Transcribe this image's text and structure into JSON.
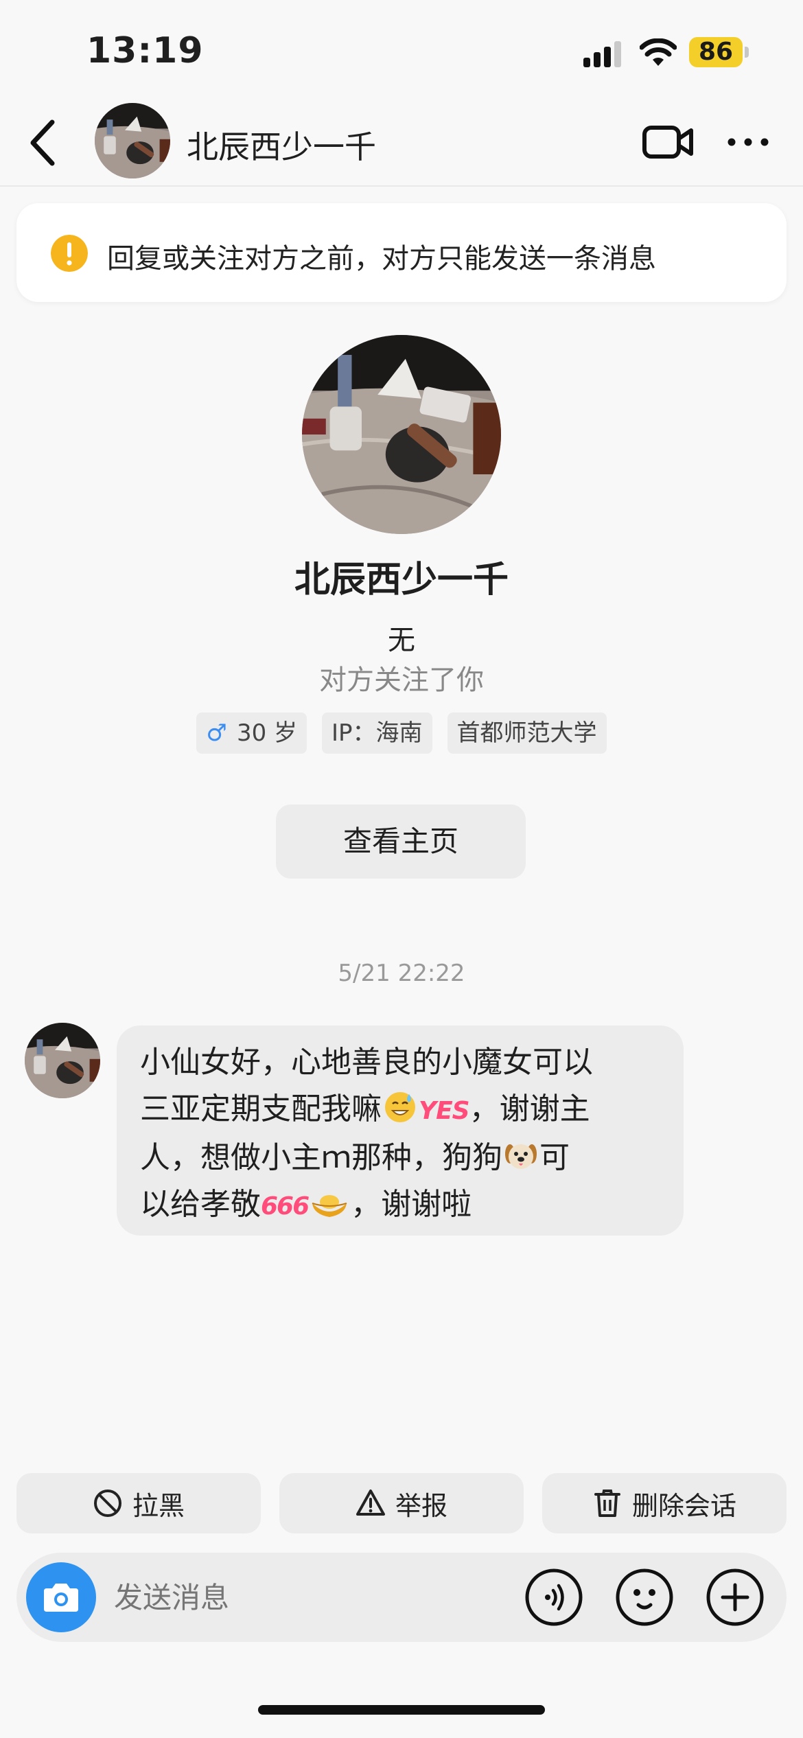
{
  "status_bar": {
    "time": "13:19",
    "battery": "86"
  },
  "header": {
    "name": "北辰西少一千"
  },
  "notice": {
    "text": "回复或关注对方之前，对方只能发送一条消息"
  },
  "profile": {
    "name": "北辰西少一千",
    "bio": "无",
    "follow_status": "对方关注了你",
    "tags": {
      "gender_symbol": "♂",
      "age": "30 岁",
      "ip": "IP：海南",
      "school": "首都师范大学"
    },
    "view_home_label": "查看主页"
  },
  "conversation": {
    "timestamp": "5/21 22:22",
    "message": {
      "line1": "小仙女好，心地善良的小魔女可以",
      "line2_pre": "三亚定期支配我嘛",
      "line2_yes": "YES",
      "line2_post": "，谢谢主",
      "line3_pre": "人，想做小主ｍ那种，狗狗",
      "line3_post": "可",
      "line4_pre": "以给孝敬",
      "line4_666": "666",
      "line4_post": "，谢谢啦"
    }
  },
  "actions": {
    "block": "拉黑",
    "report": "举报",
    "delete": "删除会话"
  },
  "composer": {
    "placeholder": "发送消息"
  },
  "icons": {
    "accent_blue": "#2e93f0",
    "warning_yellow": "#f6b51c",
    "battery_yellow": "#f4cf2a"
  }
}
